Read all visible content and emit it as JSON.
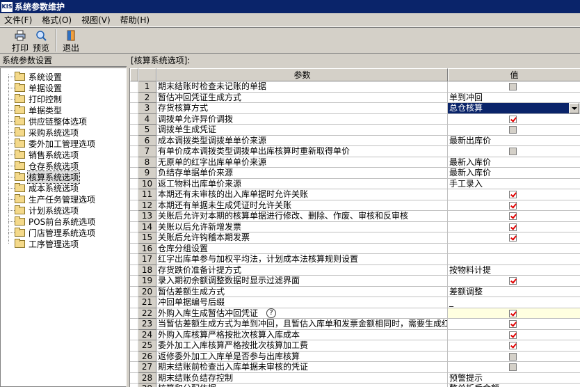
{
  "window": {
    "title": "系统参数维护",
    "logo_text": "KIS"
  },
  "menu": [
    "文件(F)",
    "格式(O)",
    "视图(V)",
    "帮助(H)"
  ],
  "toolbar": {
    "print": "打印",
    "preview": "预览",
    "exit": "退出"
  },
  "left_panel": {
    "header": "系统参数设置",
    "items": [
      "系统设置",
      "单据设置",
      "打印控制",
      "单据类型",
      "供应链整体选项",
      "采购系统选项",
      "委外加工管理选项",
      "销售系统选项",
      "仓存系统选项",
      "核算系统选项",
      "成本系统选项",
      "生产任务管理选项",
      "计划系统选项",
      "POS前台系统选项",
      "门店管理系统选项",
      "工序管理选项"
    ],
    "selected_index": 9
  },
  "right_panel": {
    "header": "[核算系统选项]:",
    "columns": {
      "param": "参数",
      "value": "值"
    },
    "rows": [
      {
        "no": "1",
        "param": "期末结账时检查未记账的单据",
        "type": "check",
        "checked": false
      },
      {
        "no": "2",
        "param": "暂估冲回凭证生成方式",
        "type": "text",
        "value": "单到冲回"
      },
      {
        "no": "3",
        "param": "存货核算方式",
        "type": "select",
        "value": "总仓核算"
      },
      {
        "no": "4",
        "param": "调拨单允许异价调拨",
        "type": "check",
        "checked": true
      },
      {
        "no": "5",
        "param": "调拨单生成凭证",
        "type": "check",
        "checked": false
      },
      {
        "no": "6",
        "param": "成本调拨类型调拨单单价来源",
        "type": "text",
        "value": "最新出库价"
      },
      {
        "no": "7",
        "param": "有单价成本调拨类型调拨单出库核算时重新取得单价",
        "type": "check",
        "checked": false
      },
      {
        "no": "8",
        "param": "无原单的红字出库单单价来源",
        "type": "text",
        "value": "最新入库价"
      },
      {
        "no": "9",
        "param": "负结存单据单价来源",
        "type": "text",
        "value": "最新入库价"
      },
      {
        "no": "10",
        "param": "返工物料出库单价来源",
        "type": "text",
        "value": "手工录入"
      },
      {
        "no": "11",
        "param": "本期还有未审核的出入库单据时允许关账",
        "type": "check",
        "checked": true
      },
      {
        "no": "12",
        "param": "本期还有单据未生成凭证时允许关账",
        "type": "check",
        "checked": true
      },
      {
        "no": "13",
        "param": "关账后允许对本期的核算单据进行修改、删除、作废、审核和反审核",
        "type": "check",
        "checked": true
      },
      {
        "no": "14",
        "param": "关账以后允许新增发票",
        "type": "check",
        "checked": true
      },
      {
        "no": "15",
        "param": "关账后允许钩稽本期发票",
        "type": "check",
        "checked": true
      },
      {
        "no": "16",
        "param": "仓库分组设置",
        "type": "text",
        "value": ""
      },
      {
        "no": "17",
        "param": "红字出库单参与加权平均法，计划成本法核算规则设置",
        "type": "text",
        "value": ""
      },
      {
        "no": "18",
        "param": "存货跌价准备计提方式",
        "type": "text",
        "value": "按物料计提"
      },
      {
        "no": "19",
        "param": "录入期初余额调整数据时显示过滤界面",
        "type": "check",
        "checked": true
      },
      {
        "no": "20",
        "param": "暂估差额生成方式",
        "type": "text",
        "value": "差额调整"
      },
      {
        "no": "21",
        "param": "冲回单据编号后缀",
        "type": "text",
        "value": "_"
      },
      {
        "no": "22",
        "param": "外购入库生成暂估冲回凭证",
        "type": "check",
        "checked": true,
        "help": "?",
        "highlight": true
      },
      {
        "no": "23",
        "param": "当暂估差额生成方式为单到冲回，且暂估入库单和发票金额相同时，需要生成红",
        "type": "check",
        "checked": true
      },
      {
        "no": "24",
        "param": "外购入库核算严格按批次核算入库成本",
        "type": "check",
        "checked": true
      },
      {
        "no": "25",
        "param": "委外加工入库核算严格按批次核算加工费",
        "type": "check",
        "checked": true
      },
      {
        "no": "26",
        "param": "返修委外加工入库单是否参与出库核算",
        "type": "check",
        "checked": false
      },
      {
        "no": "27",
        "param": "期末结账前检查出入库单据未审核的凭证",
        "type": "check",
        "checked": false
      },
      {
        "no": "28",
        "param": "期末结账负结存控制",
        "type": "text",
        "value": "预警提示"
      },
      {
        "no": "29",
        "param": "核算和分配依据",
        "type": "text",
        "value": "整单折后金额"
      }
    ]
  },
  "colors": {
    "titlebar": "#0a246a",
    "face": "#d4d0c8",
    "checkmark": "#e00000"
  }
}
